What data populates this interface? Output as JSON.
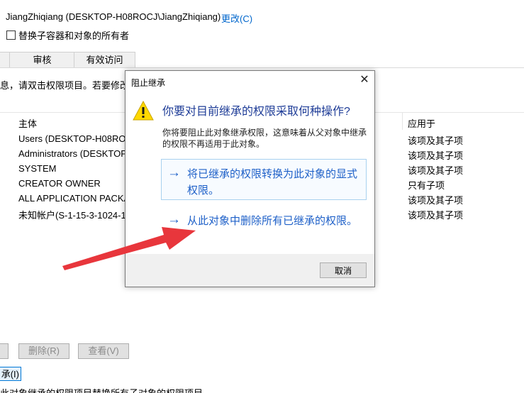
{
  "window": {
    "owner": "JiangZhiqiang (DESKTOP-H08ROCJ\\JiangZhiqiang)",
    "change_link": "更改(C)",
    "replace_owner_checkbox_label": "替换子容器和对象的所有者",
    "replace_owner_checked": false,
    "tabs": [
      "",
      "审核",
      "有效访问"
    ],
    "description": "息，请双击权限项目。若要修改"
  },
  "table": {
    "headers": {
      "principal": "主体",
      "applies_to": "应用于"
    },
    "rows": [
      {
        "principal": "Users (DESKTOP-H08ROC",
        "applies_to": "该项及其子项"
      },
      {
        "principal": "Administrators (DESKTOP-",
        "applies_to": "该项及其子项"
      },
      {
        "principal": "SYSTEM",
        "applies_to": "该项及其子项"
      },
      {
        "principal": "CREATOR OWNER",
        "applies_to": "只有子项"
      },
      {
        "principal": "ALL APPLICATION PACKAC",
        "applies_to": "该项及其子项"
      },
      {
        "principal": "未知帐户(S-1-15-3-1024-10",
        "applies_to": "该项及其子项"
      }
    ]
  },
  "buttons": {
    "remove": "删除(R)",
    "view": "查看(V)",
    "enable_inherit_fragment": "承(I)"
  },
  "bottom_text_fragment": "此对象继承的权限项目替换所有子对象的权限项目",
  "dialog": {
    "title": "阻止继承",
    "close_glyph": "✕",
    "question": "你要对目前继承的权限采取何种操作?",
    "info": "你将要阻止此对象继承权限，这意味着从父对象中继承的权限不再适用于此对象。",
    "option_convert": "将已继承的权限转换为此对象的显式权限。",
    "option_remove": "从此对象中删除所有已继承的权限。",
    "arrow_glyph": "→",
    "cancel": "取消"
  },
  "icons": {
    "warning": "warning-icon",
    "annotation": "red-arrow-annotation"
  },
  "colors": {
    "link": "#0066cc",
    "dialog_heading": "#1e3c97",
    "command_link": "#1e60c8",
    "warning_fill": "#ffd800",
    "annotation": "#e8363c"
  }
}
